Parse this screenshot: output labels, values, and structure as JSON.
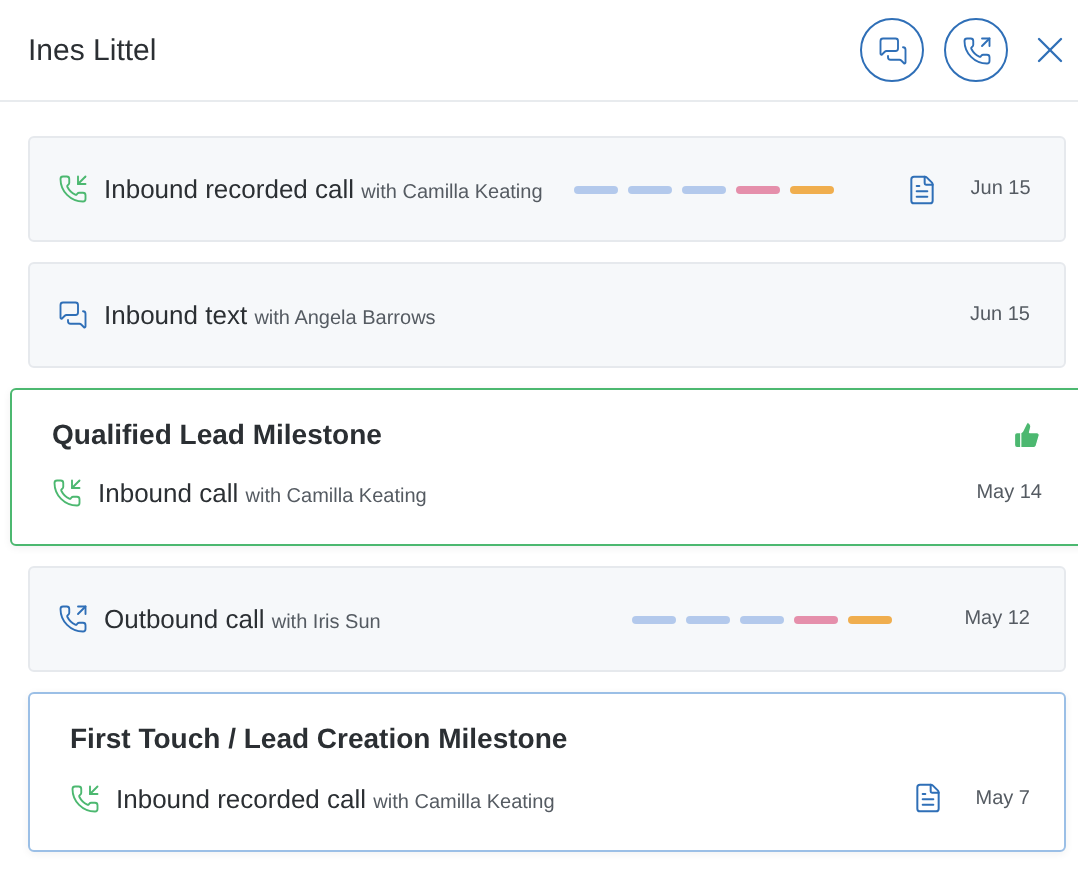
{
  "header": {
    "title": "Ines Littel"
  },
  "timeline": [
    {
      "kind": "activity",
      "activity": {
        "kind": "inbound_call",
        "title": "Inbound recorded call",
        "with": "with Camilla Keating",
        "segments": [
          {
            "color": "#b3c9ec"
          },
          {
            "color": "#b3c9ec"
          },
          {
            "color": "#b3c9ec"
          },
          {
            "color": "#e58fab"
          },
          {
            "color": "#f0ae4e"
          }
        ],
        "transcript": true,
        "date": "Jun 15"
      }
    },
    {
      "kind": "activity",
      "activity": {
        "kind": "inbound_text",
        "title": "Inbound text",
        "with": "with Angela Barrows",
        "transcript": false,
        "date": "Jun 15"
      }
    },
    {
      "kind": "milestone",
      "title": "Qualified Lead Milestone",
      "color": "#4cb870",
      "liked": true,
      "activity": {
        "kind": "inbound_call",
        "title": "Inbound call",
        "with": "with Camilla Keating",
        "transcript": false,
        "date": "May 14"
      }
    },
    {
      "kind": "activity",
      "activity": {
        "kind": "outbound_call",
        "title": "Outbound call",
        "with": "with Iris Sun",
        "segments": [
          {
            "color": "#b3c9ec"
          },
          {
            "color": "#b3c9ec"
          },
          {
            "color": "#b3c9ec"
          },
          {
            "color": "#e58fab"
          },
          {
            "color": "#f0ae4e"
          }
        ],
        "transcript": false,
        "date": "May 12"
      }
    },
    {
      "kind": "milestone",
      "title": "First Touch / Lead Creation Milestone",
      "color": "#9bbfe6",
      "liked": false,
      "activity": {
        "kind": "inbound_call",
        "title": "Inbound recorded call",
        "with": "with Camilla Keating",
        "transcript": true,
        "date": "May 7"
      }
    }
  ]
}
